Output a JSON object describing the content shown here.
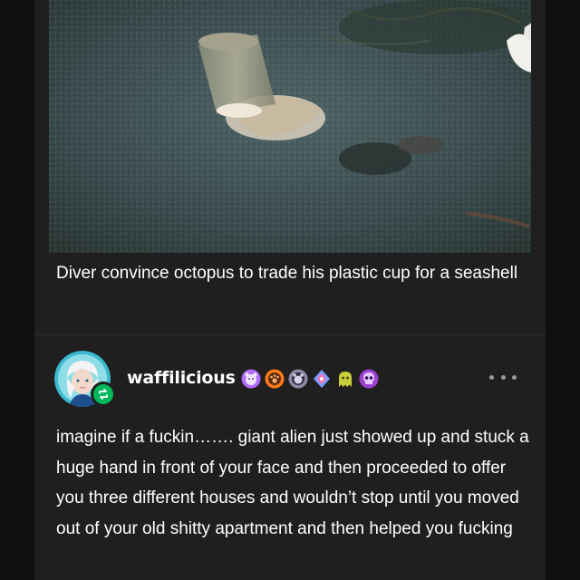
{
  "video": {
    "caption": "Diver convince octopus to trade his plastic cup for a seashell"
  },
  "post": {
    "username": "waffilicious",
    "body": "imagine if a fuckin……. giant alien just showed up and stuck a huge hand in front of your face and then proceeded to offer you three different houses and wouldn’t stop until you moved out of your old shitty apartment and then helped you fucking",
    "badges": [
      {
        "name": "purple-bear-badge-icon",
        "color": "#b16cff"
      },
      {
        "name": "orange-paw-badge-icon",
        "color": "#ff7a1a"
      },
      {
        "name": "grey-bear-badge-icon",
        "color": "#8f8aa8"
      },
      {
        "name": "crystal-badge-icon",
        "color": "#7aa0ff"
      },
      {
        "name": "yellow-ghost-badge-icon",
        "color": "#c9cf3a"
      },
      {
        "name": "purple-skull-badge-icon",
        "color": "#9b3fd1"
      }
    ]
  },
  "colors": {
    "background": "#0f0f0f",
    "card": "#1f1f1f",
    "reblog": "#00b85c"
  }
}
